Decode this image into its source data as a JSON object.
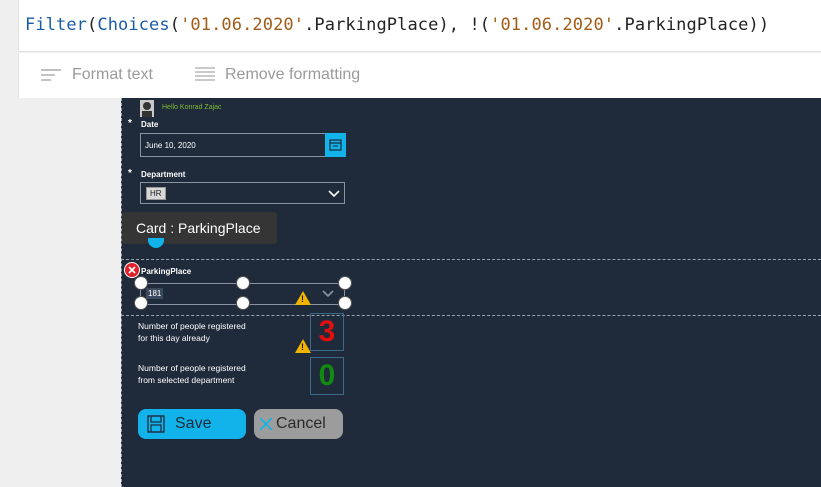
{
  "formula": {
    "tokens": [
      {
        "t": "Filter",
        "c": "fn"
      },
      {
        "t": "(",
        "c": "pl"
      },
      {
        "t": "Choices",
        "c": "fn"
      },
      {
        "t": "(",
        "c": "pl"
      },
      {
        "t": "'01.06.2020'",
        "c": "str"
      },
      {
        "t": ".ParkingPlace), !(",
        "c": "pl"
      },
      {
        "t": "'01.06.2020'",
        "c": "str"
      },
      {
        "t": ".ParkingPlace))",
        "c": "pl"
      }
    ]
  },
  "toolbar": {
    "format_text": "Format text",
    "remove_formatting": "Remove formatting"
  },
  "app": {
    "greeting": "Hello Konrad Zajac",
    "date_label": "Date",
    "date_value": "June 10, 2020",
    "department_label": "Department",
    "department_value": "HR",
    "parking_label": "ParkingPlace",
    "parking_value": "181",
    "required_mark": "*",
    "registered_day_label_1": "Number of people registered",
    "registered_day_label_2": "for this day already",
    "registered_day_count": "3",
    "registered_dept_label_1": "Number of people registered",
    "registered_dept_label_2": "from selected department",
    "registered_dept_count": "0",
    "save_label": "Save",
    "cancel_label": "Cancel"
  },
  "tooltip": {
    "text": "Card : ParkingPlace"
  },
  "colors": {
    "canvas_bg": "#1f2a3a",
    "save_bg": "#11b3ea",
    "cancel_bg": "#9c9c9c",
    "count_day": "#e01010",
    "count_dept": "#118a11",
    "greeting": "#7dbb34",
    "warning": "#f2b400"
  }
}
